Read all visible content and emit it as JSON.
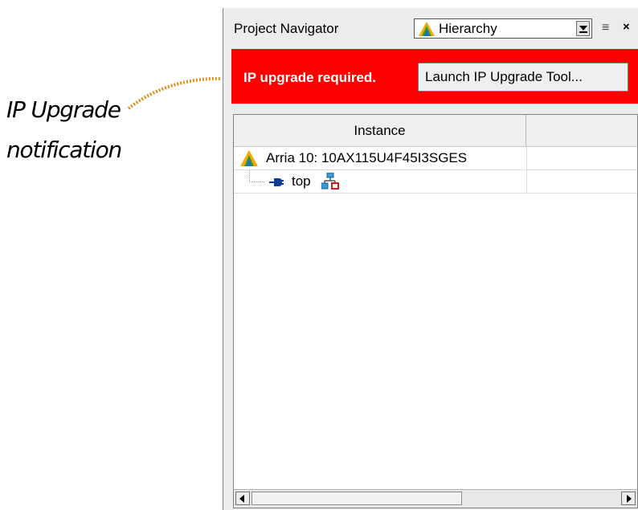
{
  "annotation": {
    "line1": "IP Upgrade",
    "line2": "notification",
    "leader_color": "#d98e1c"
  },
  "panel": {
    "title": "Project Navigator",
    "view_select": {
      "selected": "Hierarchy",
      "icon": "quartus-logo-icon"
    },
    "menu_icon": "≡",
    "close_icon": "×"
  },
  "banner": {
    "message": "IP upgrade required.",
    "button_label": "Launch IP Upgrade Tool...",
    "color": "#ff0000"
  },
  "table": {
    "columns": [
      "Instance",
      ""
    ],
    "rows": [
      {
        "label": "Arria 10: 10AX115U4F45I3SGES",
        "icon": "arria-device-icon"
      },
      {
        "label": "top",
        "icon": "entity-plug-icon",
        "badge_icon": "hierarchy-icon"
      }
    ]
  }
}
